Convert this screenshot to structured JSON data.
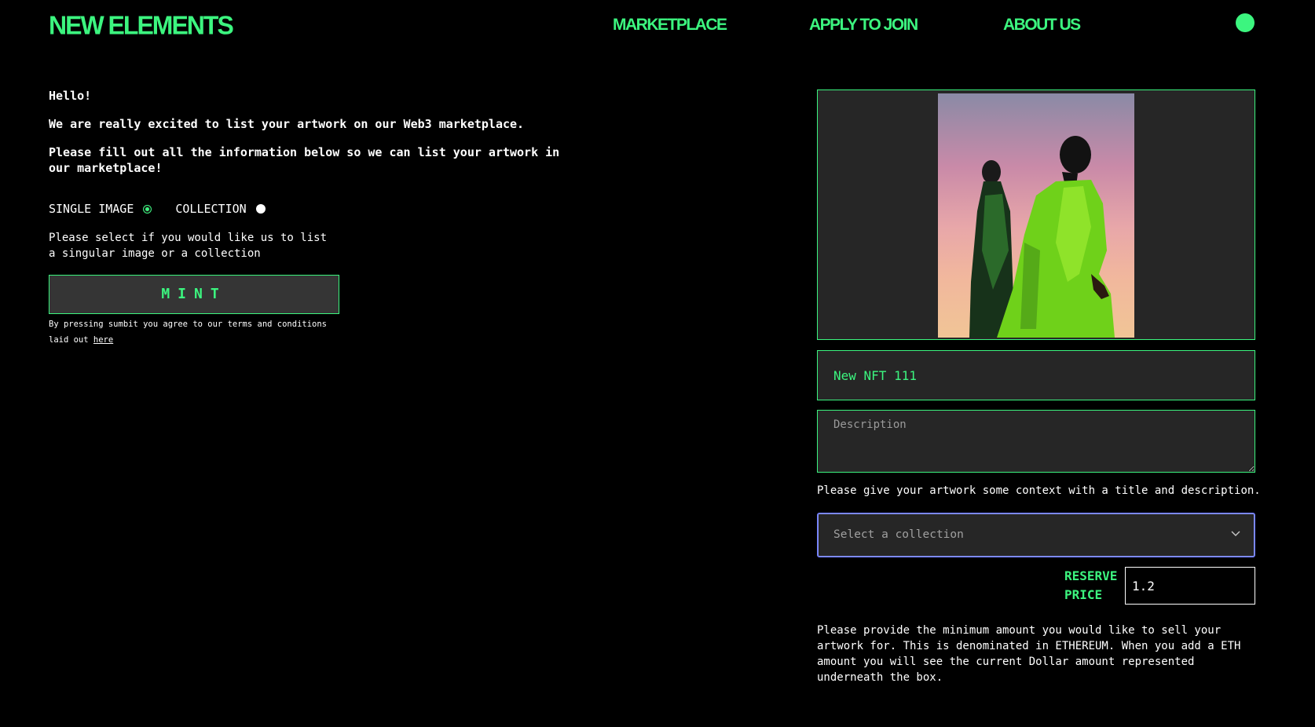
{
  "header": {
    "logo": "NEW ELEMENTS",
    "nav": [
      "MARKETPLACE",
      "APPLY TO JOIN",
      "ABOUT US"
    ]
  },
  "intro": {
    "greeting": "Hello!",
    "line1": "We are really excited to list your artwork on our Web3 marketplace.",
    "line2": "Please fill out all the information below so we can list your artwork in our marketplace!"
  },
  "listing_type": {
    "options": [
      "SINGLE IMAGE",
      "COLLECTION"
    ],
    "selected": "SINGLE IMAGE",
    "help": "Please select if you would like us to list a singular image or a collection"
  },
  "mint": {
    "label": "MINT",
    "terms_text": "By pressing sumbit you agree to our terms and conditions laid out",
    "terms_link": "here"
  },
  "form": {
    "title_value": "New NFT 111",
    "description_placeholder": "Description",
    "context_help": "Please give your artwork some context with a title and description.",
    "collection_placeholder": "Select a collection",
    "reserve_label": "RESERVE PRICE",
    "reserve_value": "1.2",
    "reserve_help": "Please provide the minimum amount you would like to sell your artwork for. This is denominated in ETHEREUM. When you add a ETH amount you will see the current Dollar amount represented underneath the box."
  },
  "colors": {
    "accent": "#3cf57f",
    "background": "#000000",
    "field_bg": "#262626",
    "focus": "#6a78ff"
  },
  "icons": [
    "chevron-down-icon",
    "user-avatar"
  ]
}
